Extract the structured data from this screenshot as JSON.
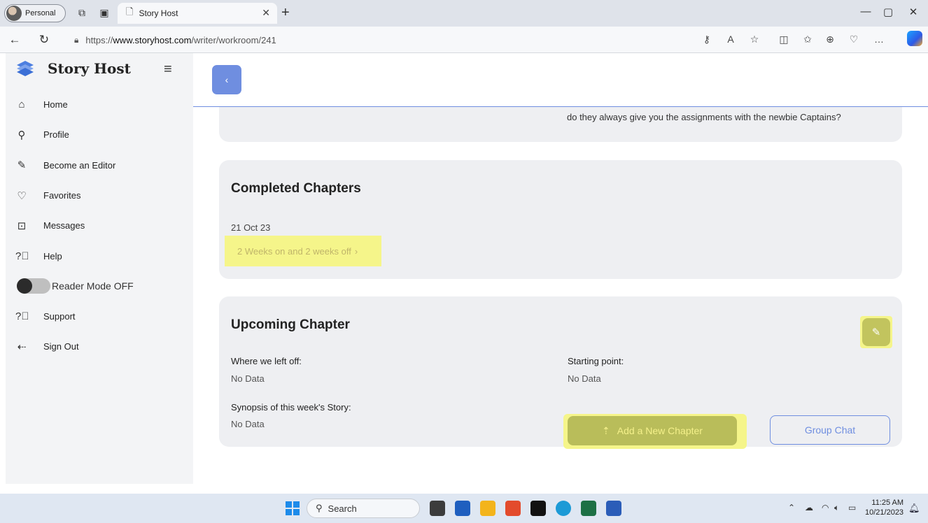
{
  "browser": {
    "profile_label": "Personal",
    "tab_title": "Story Host",
    "url_prefix": "https://",
    "url_host": "www.storyhost.com",
    "url_path": "/writer/workroom/241"
  },
  "sidebar": {
    "brand": "Story Host",
    "items": [
      {
        "label": "Home",
        "icon": "home-icon"
      },
      {
        "label": "Profile",
        "icon": "user-icon"
      },
      {
        "label": "Become an Editor",
        "icon": "pencil-circle-icon"
      },
      {
        "label": "Favorites",
        "icon": "heart-icon"
      },
      {
        "label": "Messages",
        "icon": "inbox-icon"
      },
      {
        "label": "Help",
        "icon": "question-icon"
      }
    ],
    "reader_mode_label": "Reader Mode OFF",
    "items_after": [
      {
        "label": "Support",
        "icon": "question-icon"
      },
      {
        "label": "Sign Out",
        "icon": "sign-out-icon"
      }
    ]
  },
  "previous_card": {
    "text": "do they always give you the assignments with the newbie Captains?"
  },
  "completed": {
    "title": "Completed Chapters",
    "date": "21 Oct 23",
    "chapter_link": "2 Weeks on and 2 weeks off"
  },
  "upcoming": {
    "title": "Upcoming Chapter",
    "where_left_off_label": "Where we left off:",
    "where_left_off_value": "No Data",
    "starting_point_label": "Starting point:",
    "starting_point_value": "No Data",
    "synopsis_label": "Synopsis of this week's Story:",
    "synopsis_value": "No Data",
    "add_chapter_label": "Add a New Chapter",
    "group_chat_label": "Group Chat"
  },
  "taskbar": {
    "search_label": "Search",
    "time": "11:25 AM",
    "date": "10/21/2023"
  },
  "colors": {
    "accent": "#6f8ee0",
    "highlight": "#f5f58a",
    "card_bg": "#eeeff2"
  }
}
